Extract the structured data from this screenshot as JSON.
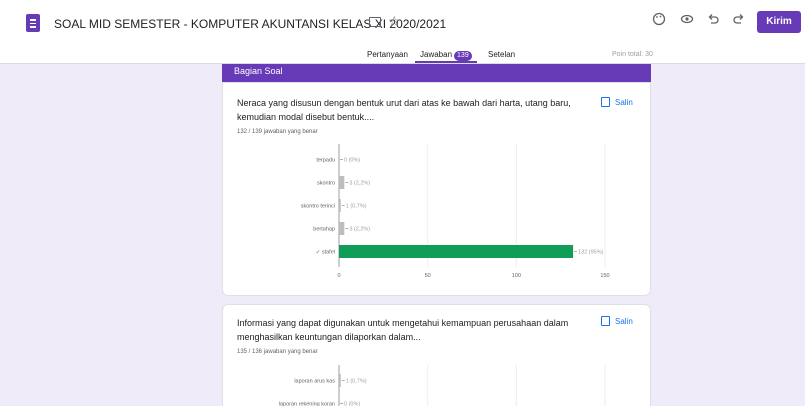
{
  "header": {
    "title": "SOAL MID SEMESTER - KOMPUTER AKUNTANSI KELAS XI 2020/2021",
    "send_label": "Kirim",
    "icons": [
      "palette-icon",
      "eye-icon",
      "undo-icon",
      "redo-icon"
    ]
  },
  "tabs": {
    "questions": "Pertanyaan",
    "responses": "Jawaban",
    "responses_count": "139",
    "settings": "Setelan"
  },
  "points_total": "Poin total: 30",
  "section_title": "Bagian Soal",
  "copy_label": "Salin",
  "colors": {
    "accent": "#673ab7",
    "correct_bar": "#0f9d58",
    "wrong_bar": "#bdbdbd",
    "link": "#1a73e8"
  },
  "questions": [
    {
      "text": "Neraca yang disusun dengan bentuk urut dari atas ke bawah dari harta, utang baru, kemudian modal disebut bentuk....",
      "score": "132 / 139 jawaban yang benar"
    },
    {
      "text": "Informasi yang dapat digunakan untuk mengetahui kemampuan perusahaan dalam menghasilkan keuntungan dilaporkan dalam...",
      "score": "135 / 136 jawaban yang benar"
    }
  ],
  "chart_data": [
    {
      "type": "bar",
      "orientation": "horizontal",
      "categories": [
        "terpadu",
        "skontro",
        "skontro terinci",
        "bertahap",
        "✓ stafel"
      ],
      "values": [
        0,
        3,
        1,
        3,
        132
      ],
      "value_labels": [
        "0 (0%)",
        "3 (2,2%)",
        "1 (0,7%)",
        "3 (2,2%)",
        "132 (95%)"
      ],
      "correct_index": 4,
      "xticks": [
        "0",
        "50",
        "100",
        "150"
      ],
      "xlim": [
        0,
        150
      ]
    },
    {
      "type": "bar",
      "orientation": "horizontal",
      "categories": [
        "laporan arus kas",
        "laporan rekening koran"
      ],
      "values": [
        1,
        0
      ],
      "value_labels": [
        "1 (0,7%)",
        "0 (0%)"
      ],
      "xlim": [
        0,
        150
      ]
    }
  ]
}
